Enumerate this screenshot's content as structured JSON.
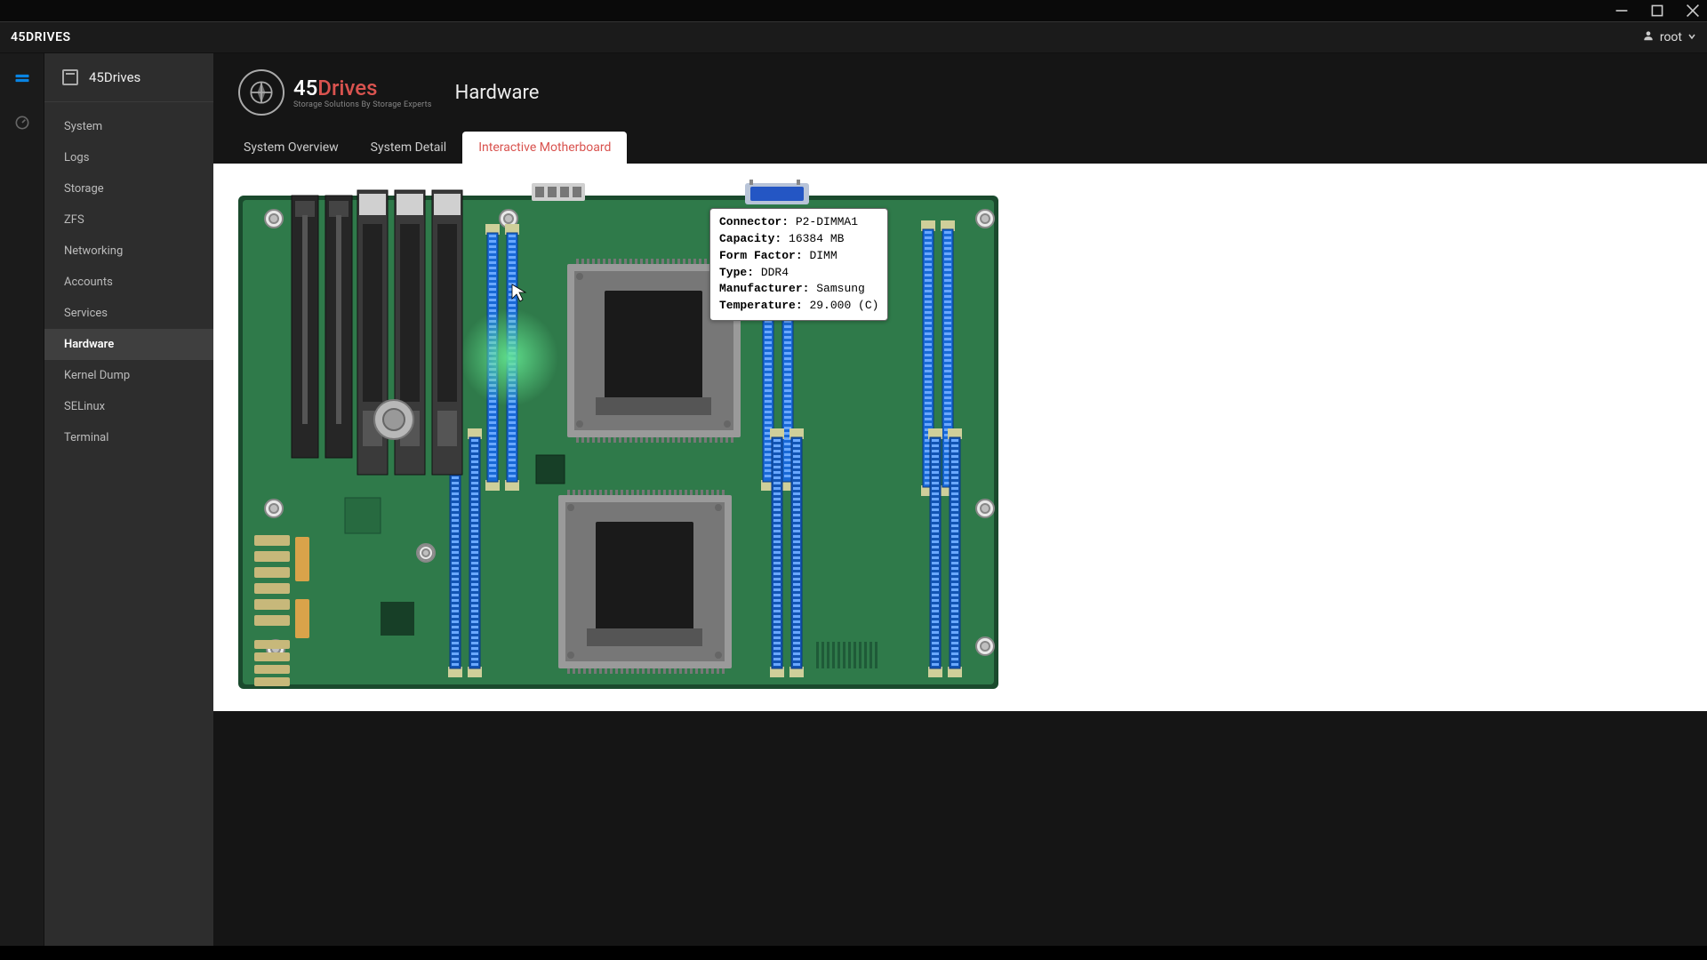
{
  "window": {
    "brand": "45DRIVES",
    "user": "root"
  },
  "sidebar": {
    "module_name": "45Drives",
    "items": [
      {
        "label": "System"
      },
      {
        "label": "Logs"
      },
      {
        "label": "Storage"
      },
      {
        "label": "ZFS"
      },
      {
        "label": "Networking"
      },
      {
        "label": "Accounts"
      },
      {
        "label": "Services"
      },
      {
        "label": "Hardware"
      },
      {
        "label": "Kernel Dump"
      },
      {
        "label": "SELinux"
      },
      {
        "label": "Terminal"
      }
    ],
    "active_index": 7
  },
  "header": {
    "logo_main_a": "45",
    "logo_main_b": "Drives",
    "logo_tagline": "Storage Solutions By Storage Experts",
    "page_title": "Hardware"
  },
  "tabs": {
    "items": [
      {
        "label": "System Overview"
      },
      {
        "label": "System Detail"
      },
      {
        "label": "Interactive Motherboard"
      }
    ],
    "active_index": 2
  },
  "tooltip": {
    "fields": {
      "Connector": "P2-DIMMA1",
      "Capacity": "16384 MB",
      "Form Factor": "DIMM",
      "Type": "DDR4",
      "Manufacturer": "Samsung",
      "Temperature": "29.000 (C)"
    }
  },
  "motherboard": {
    "colors": {
      "pcb": "#2f7a4a",
      "pcb_dark": "#276a40",
      "border": "#1a4a2d",
      "dimm": "#1869d6",
      "dimm_empty": "#0f4a9e",
      "cpu_socket": "#8a8a8a",
      "cpu_die": "#1a1a1a",
      "screw": "#cfcfcf",
      "pcie_card": "#2b2b2b",
      "sata_conn": "#d9a34a",
      "header_pin": "#d0b060",
      "glow": "#64e892"
    }
  }
}
